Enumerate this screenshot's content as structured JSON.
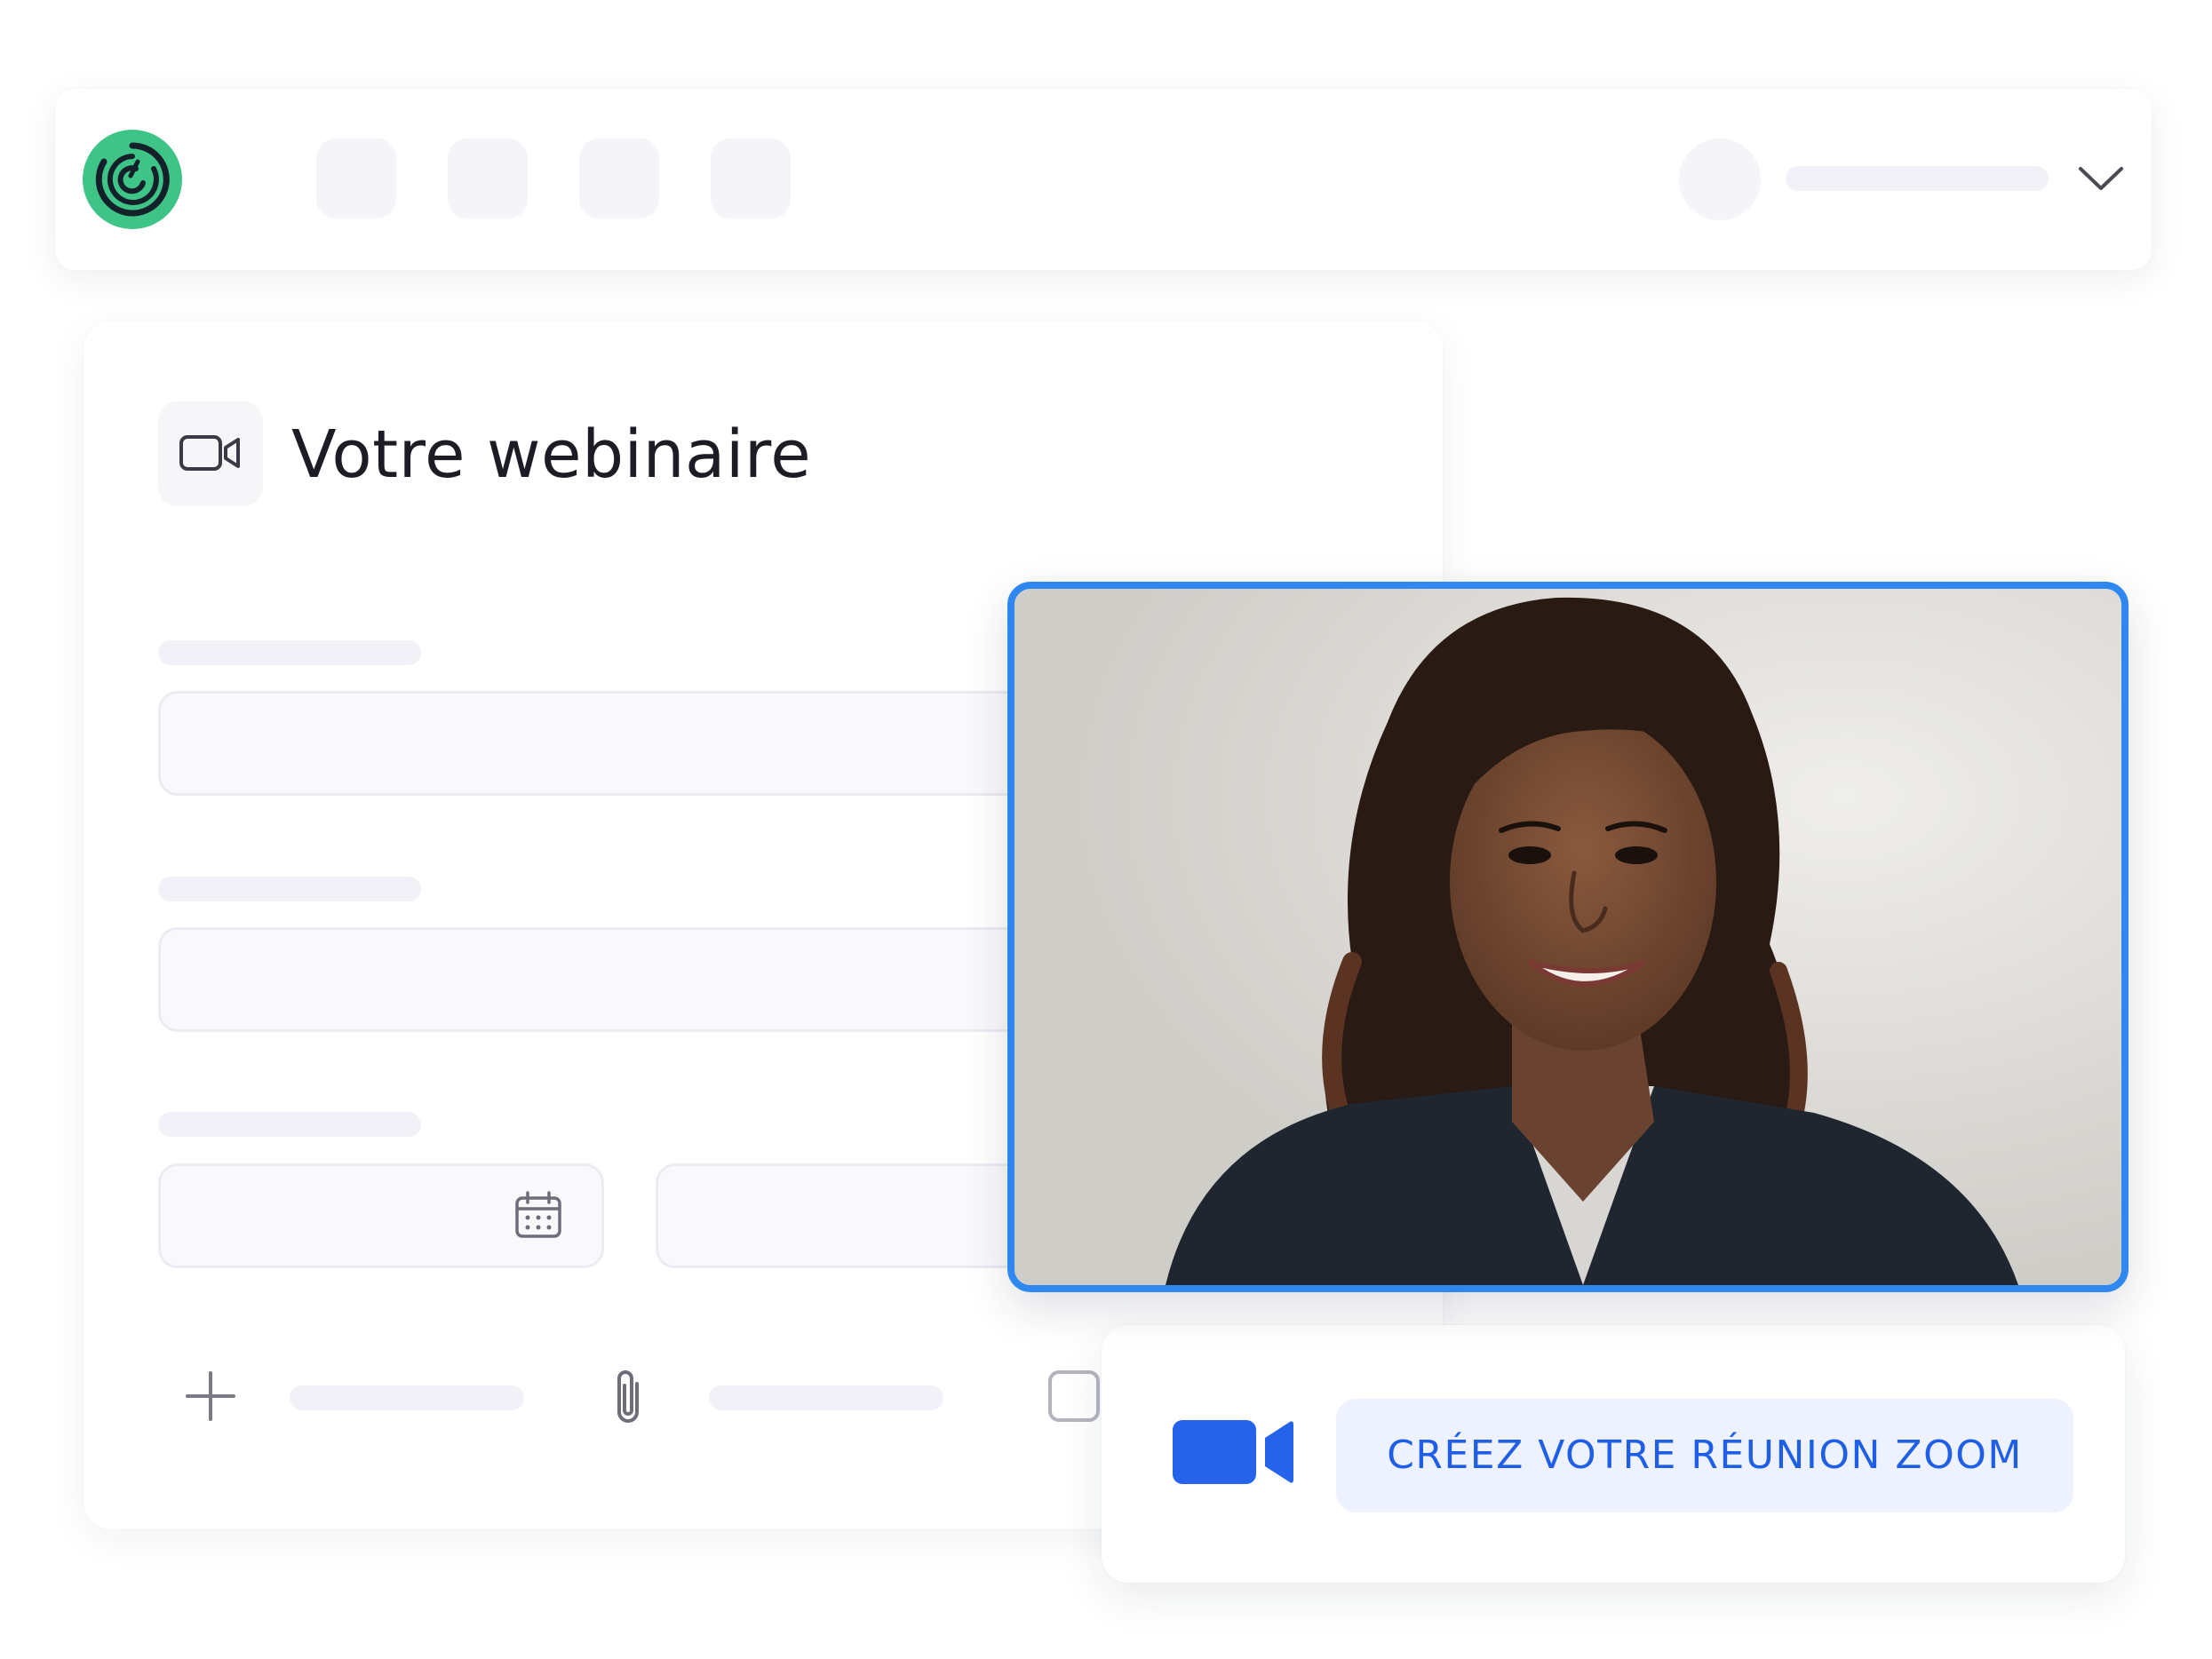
{
  "app": {
    "logo_icon": "app-logo-icon",
    "brand_color": "#3ec487"
  },
  "header": {
    "chevron_icon": "chevron-down-icon"
  },
  "form": {
    "title": "Votre webinaire",
    "title_icon": "video-camera-icon",
    "date_icon": "calendar-icon",
    "add_icon": "plus-icon",
    "attach_icon": "paperclip-icon",
    "checkbox_icon": "checkbox-icon"
  },
  "zoom": {
    "button_label": "CRÉEZ VOTRE RÉUNION ZOOM",
    "icon": "zoom-video-camera-icon",
    "accent": "#1f5ee6"
  },
  "video": {
    "frame_color": "#2f88f0",
    "content": "webcam-participant-photo"
  }
}
